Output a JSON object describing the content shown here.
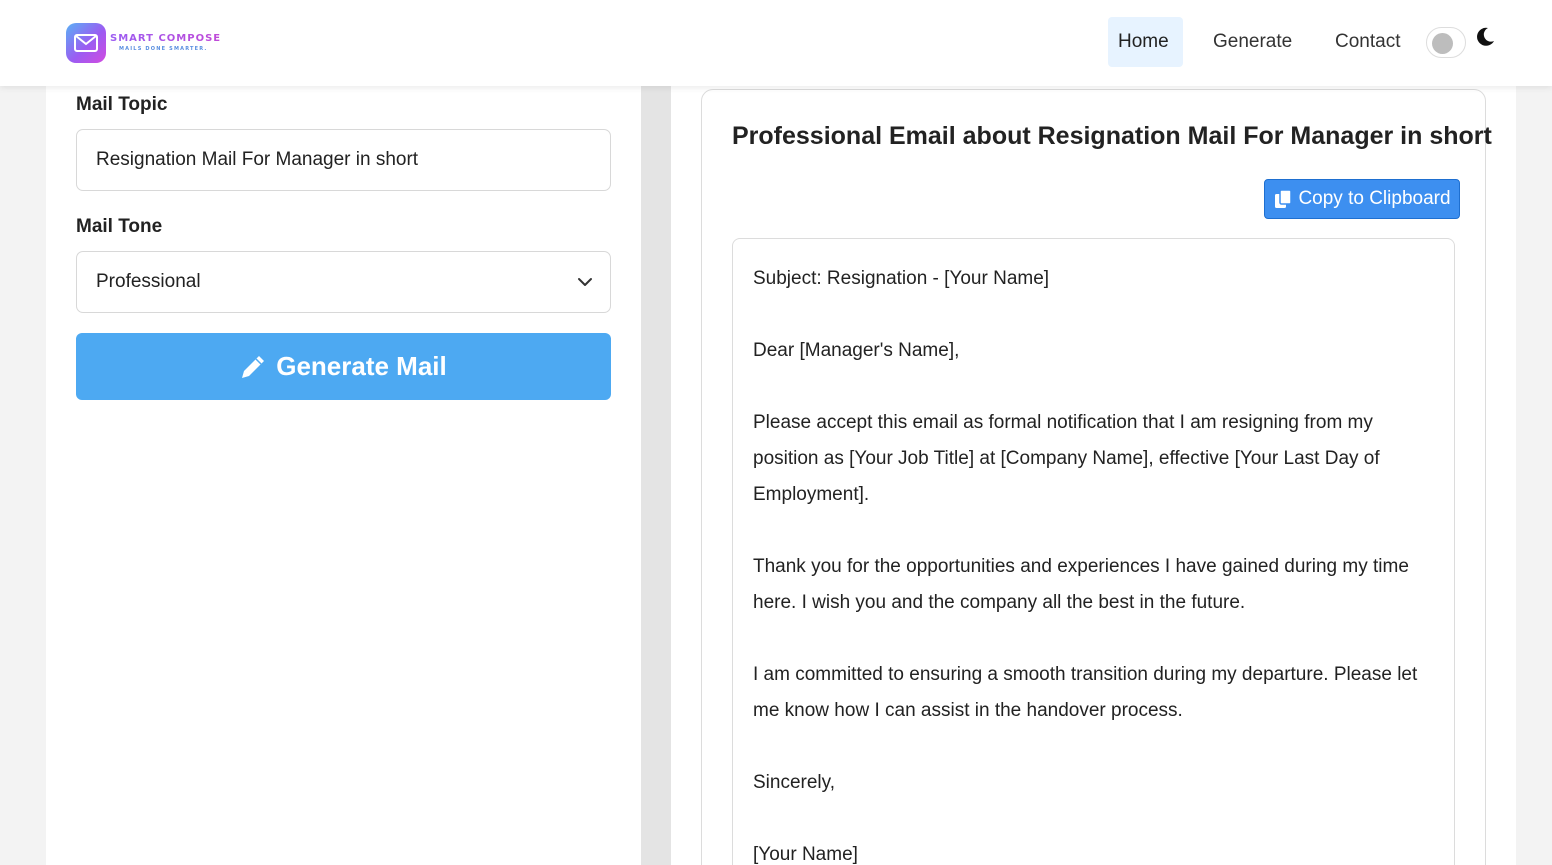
{
  "brand": {
    "name": "SMART COMPOSE",
    "tagline": "MAILS DONE SMARTER.",
    "logo_icon": "envelope-icon"
  },
  "nav": {
    "items": [
      {
        "label": "Home",
        "active": true
      },
      {
        "label": "Generate",
        "active": false
      },
      {
        "label": "Contact",
        "active": false
      }
    ],
    "theme_toggle": {
      "state": "off",
      "icon": "moon-icon"
    }
  },
  "form": {
    "topic_label": "Mail Topic",
    "topic_value": "Resignation Mail For Manager in short",
    "tone_label": "Mail Tone",
    "tone_value": "Professional",
    "generate_button": "Generate Mail",
    "generate_icon": "pencil-icon"
  },
  "result": {
    "title": "Professional Email about Resignation Mail For Manager in short",
    "copy_button": "Copy to Clipboard",
    "copy_icon": "clipboard-copy-icon",
    "email_lines": [
      "Subject: Resignation - [Your Name]",
      "Dear [Manager's Name],",
      "Please accept this email as formal notification that I am resigning from my position as [Your Job Title] at [Company Name], effective [Your Last Day of Employment].",
      "Thank you for the opportunities and experiences I have gained during my time here. I wish you and the company all the best in the future.",
      "I am committed to ensuring a smooth transition during my departure. Please let me know how I can assist in the handover process.",
      "Sincerely,",
      "[Your Name]"
    ]
  },
  "colors": {
    "primary_button": "#4da9f2",
    "copy_button": "#3d8ff0",
    "active_nav_bg": "#e7f3ff"
  }
}
